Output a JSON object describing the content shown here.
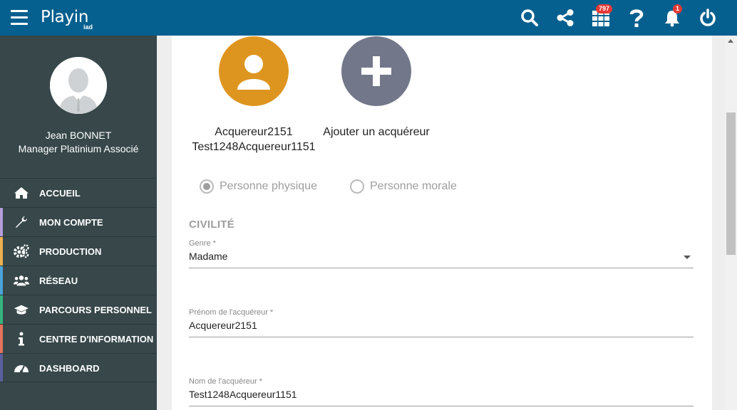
{
  "header": {
    "logo": "Playin",
    "logo_sub": "iad",
    "icons": {
      "search": "search-icon",
      "share": "share-icon",
      "apps": "grid-icon",
      "help": "question-icon",
      "notifications": "bell-icon",
      "power": "power-icon"
    },
    "apps_badge": "797",
    "notif_badge": "1"
  },
  "user": {
    "name": "Jean BONNET",
    "role": "Manager Platinium Associé"
  },
  "sidebar": {
    "items": [
      {
        "label": "ACCUEIL",
        "icon": "home-icon",
        "color": "#37474a"
      },
      {
        "label": "MON COMPTE",
        "icon": "wrench-icon",
        "color": "#b39ddb"
      },
      {
        "label": "PRODUCTION",
        "icon": "gears-icon",
        "color": "#f0b04e"
      },
      {
        "label": "RÉSEAU",
        "icon": "users-icon",
        "color": "#4aa3d9"
      },
      {
        "label": "PARCOURS PERSONNEL",
        "icon": "graduation-cap-icon",
        "color": "#35b37e"
      },
      {
        "label": "CENTRE D'INFORMATION",
        "icon": "info-icon",
        "color": "#e5735a"
      },
      {
        "label": "DASHBOARD",
        "icon": "gauge-icon",
        "color": "#5b5e9e"
      }
    ]
  },
  "acquirers": {
    "current": {
      "line1": "Acquereur2151",
      "line2": "Test1248Acquereur1151",
      "color": "#de9520"
    },
    "add": {
      "label": "Ajouter un acquéreur",
      "color": "#727789"
    }
  },
  "person_type": {
    "options": [
      "Personne physique",
      "Personne morale"
    ],
    "selected": "Personne physique"
  },
  "form": {
    "section": "CIVILITÉ",
    "genre_label": "Genre *",
    "genre_value": "Madame",
    "firstname_label": "Prénom de l'acquéreur *",
    "firstname_value": "Acquereur2151",
    "lastname_label": "Nom de l'acquéreur *",
    "lastname_value": "Test1248Acquereur1151"
  }
}
